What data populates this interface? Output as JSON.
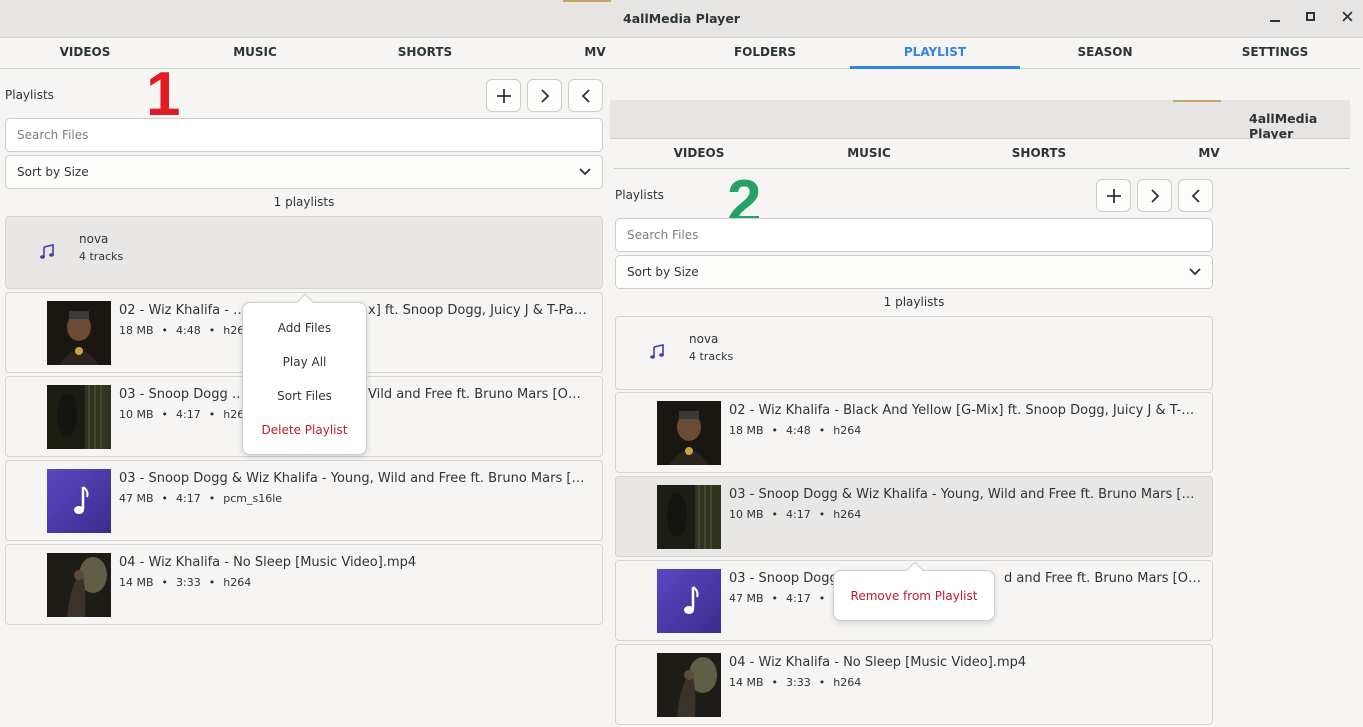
{
  "window": {
    "title": "4allMedia Player"
  },
  "colors": {
    "accent": "#3584e4",
    "danger": "#c01c28",
    "marker_1": "#e01b24",
    "marker_2": "#26a269",
    "note_bg": "#4c3aa8"
  },
  "tabs": [
    "VIDEOS",
    "MUSIC",
    "SHORTS",
    "MV",
    "FOLDERS",
    "PLAYLIST",
    "SEASON",
    "SETTINGS"
  ],
  "active_tab": "PLAYLIST",
  "inner_tabs": [
    "VIDEOS",
    "MUSIC",
    "SHORTS",
    "MV"
  ],
  "playlists_label": "Playlists",
  "search_placeholder": "Search Files",
  "sort_value": "Sort by Size",
  "playlist_count": "1 playlists",
  "playlist": {
    "name": "nova",
    "tracks": "4 tracks"
  },
  "tracks": [
    {
      "title": "02 - Wiz Khalifa - Black And Yellow [G-Mix] ft. Snoop Dogg, Juicy J & T-Pain....",
      "size": "18 MB",
      "duration": "4:48",
      "codec": "h264",
      "thumb": "video-dark-1"
    },
    {
      "title": "03 - Snoop Dogg & Wiz Khalifa - Young, Wild and Free ft. Bruno Mars [Offic...",
      "size": "10 MB",
      "duration": "4:17",
      "codec": "h264",
      "thumb": "video-dark-2"
    },
    {
      "title": "03 - Snoop Dogg & Wiz Khalifa - Young, Wild and Free ft. Bruno Mars [Offic...",
      "size": "47 MB",
      "duration": "4:17",
      "codec": "pcm_s16le",
      "thumb": "music-note-icon"
    },
    {
      "title": "04 - Wiz Khalifa - No Sleep [Music Video].mp4",
      "size": "14 MB",
      "duration": "3:33",
      "codec": "h264",
      "thumb": "video-dark-3"
    }
  ],
  "popover_left": {
    "items": [
      "Add Files",
      "Play All",
      "Sort Files"
    ],
    "danger_item": "Delete Playlist"
  },
  "popover_right": {
    "danger_item": "Remove from Playlist"
  },
  "window_controls": {
    "minimize": "‒",
    "maximize": "▪",
    "close": "✕"
  },
  "markers": {
    "left": "1",
    "right": "2"
  },
  "left_track_partial": {
    "t0": "02 - Wiz Khalifa - Bla",
    "t0_tail": "x] ft. Snoop Dogg, Juicy J & T-Pain....",
    "t1": "03 - Snoop Dogg & W",
    "t1_tail": "Vild and Free ft. Bruno Mars [Offic..."
  },
  "right_track_partial": {
    "t2": "03 - Snoop Dogg",
    "t2_tail": "d and Free ft. Bruno Mars [Offic...",
    "t2_meta_codec": "pc"
  }
}
